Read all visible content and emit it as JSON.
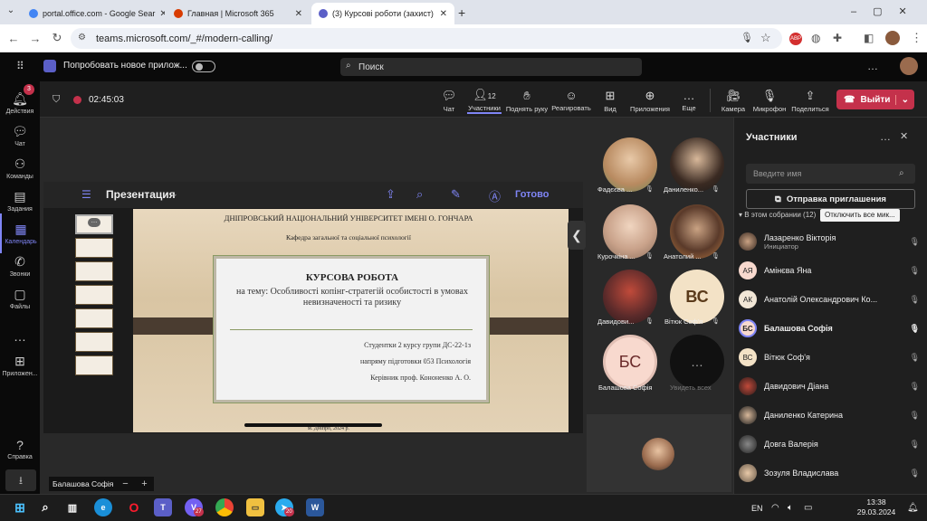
{
  "browser": {
    "tabs": [
      {
        "title": "portal.office.com - Google Sear",
        "color": "#4285f4"
      },
      {
        "title": "Главная | Microsoft 365",
        "color": "#d83b01"
      },
      {
        "title": "(3) Курсові роботи (захист)",
        "color": "#5b5fc7"
      }
    ],
    "url": "teams.microsoft.com/_#/modern-calling/"
  },
  "teams": {
    "try_new": "Попробовать новое прилож...",
    "search_placeholder": "Поиск",
    "rail": [
      {
        "label": "Действия",
        "icon": "bell-icon",
        "badge": "3"
      },
      {
        "label": "Чат",
        "icon": "chat-icon"
      },
      {
        "label": "Команды",
        "icon": "teams-icon"
      },
      {
        "label": "Задания",
        "icon": "assignments-icon"
      },
      {
        "label": "Календарь",
        "icon": "calendar-icon"
      },
      {
        "label": "Звонки",
        "icon": "phone-icon"
      },
      {
        "label": "Файлы",
        "icon": "files-icon"
      },
      {
        "label": "Приложен...",
        "icon": "apps-icon"
      },
      {
        "label": "Справка",
        "icon": "help-icon"
      }
    ]
  },
  "meeting": {
    "timer": "02:45:03",
    "participants_count": "12",
    "tools": [
      "Чат",
      "Участники",
      "Поднять руку",
      "Реагировать",
      "Вид",
      "Приложения",
      "Еще",
      "Камера",
      "Микрофон",
      "Поделиться"
    ],
    "leave": "Выйти"
  },
  "presentation": {
    "title": "Презентация",
    "done": "Готово",
    "university": "ДНІПРОВСЬКИЙ НАЦІОНАЛЬНИЙ УНІВЕРСИТЕТ ІМЕНІ О. ГОНЧАРА",
    "department": "Кафедра загальної та соціальної психології",
    "heading": "КУРСОВА РОБОТА",
    "topic": "на тему: Особливості копінг-стратегій особистості в умовах невизначеності та ризику",
    "student": "Студентки 2 курсу групи ДС-22-1з",
    "direction": "напряму підготовки 053 Психологія",
    "advisor": "Керівник проф. Кононенко А. О.",
    "footer": "м. Дніпро, 2024 р."
  },
  "gallery": [
    {
      "name": "Фадєєва ..."
    },
    {
      "name": "Даниленко..."
    },
    {
      "name": "Курочкіна ..."
    },
    {
      "name": "Анатолий ..."
    },
    {
      "name": "Давидови..."
    },
    {
      "name": "Вітюк Соф'я",
      "initials": "ВС"
    },
    {
      "name": "Балашова Софія",
      "initials": "БС"
    },
    {
      "name": "Увидеть всех"
    }
  ],
  "self_label": "Балашова Софія",
  "panel": {
    "title": "Участники",
    "search_placeholder": "Введите имя",
    "invite": "Отправка приглашения",
    "section": "В этом собрании (12)",
    "mute_all": "Отключить все мик...",
    "people": [
      {
        "name": "Лазаренко Вікторія",
        "role": "Инициатор",
        "initials": ""
      },
      {
        "name": "Амінєва Яна",
        "initials": "АЯ"
      },
      {
        "name": "Анатолій Олександрович Ко...",
        "initials": "АК"
      },
      {
        "name": "Балашова Софія",
        "initials": "БС"
      },
      {
        "name": "Вітюк Соф'я",
        "initials": "ВС"
      },
      {
        "name": "Давидович Діана",
        "initials": ""
      },
      {
        "name": "Даниленко Катерина",
        "initials": ""
      },
      {
        "name": "Довга Валерія",
        "initials": ""
      },
      {
        "name": "Зозуля Владислава",
        "initials": ""
      }
    ]
  },
  "taskbar": {
    "lang": "EN",
    "time": "13:38",
    "date": "29.03.2024",
    "teams_badge": "27",
    "telegram_badge": "20"
  }
}
